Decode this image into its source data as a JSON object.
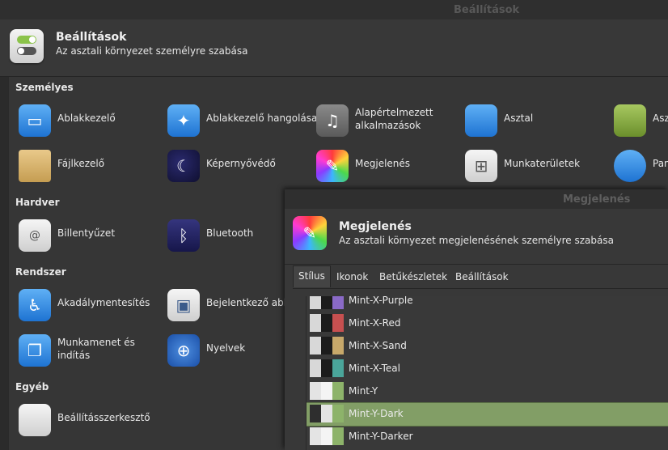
{
  "window": {
    "title": "Beállítások"
  },
  "header": {
    "title": "Beállítások",
    "subtitle": "Az asztali környezet személyre szabása"
  },
  "sections": {
    "personal": "Személyes",
    "hardware": "Hardver",
    "system": "Rendszer",
    "other": "Egyéb"
  },
  "items": {
    "window_manager": "Ablakkezelő",
    "wm_tweaks": "Ablakkezelő hangolása",
    "default_apps_1": "Alapértelmezett",
    "default_apps_2": "alkalmazások",
    "desktop": "Asztal",
    "desktop_next": "Asz",
    "file_manager": "Fájlkezelő",
    "screensaver": "Képernyővédő",
    "appearance": "Megjelenés",
    "workspaces": "Munkaterületek",
    "panel": "Pan",
    "keyboard": "Billentyűzet",
    "bluetooth": "Bluetooth",
    "accessibility": "Akadálymentesítés",
    "login": "Bejelentkező abla",
    "session_1": "Munkamenet és",
    "session_2": "indítás",
    "languages": "Nyelvek",
    "settings_editor": "Beállításszerkesztő"
  },
  "dialog": {
    "title": "Megjelenés",
    "header_title": "Megjelenés",
    "header_subtitle": "Az asztali környezet megjelenésének személyre szabása",
    "tabs": [
      "Stílus",
      "Ikonok",
      "Betűkészletek",
      "Beállítások"
    ],
    "active_tab": "Stílus",
    "themes": [
      "Mint-X-Purple",
      "Mint-X-Red",
      "Mint-X-Sand",
      "Mint-X-Teal",
      "Mint-Y",
      "Mint-Y-Dark",
      "Mint-Y-Darker"
    ],
    "selected_theme": "Mint-Y-Dark",
    "accent_colors": [
      "#8a6ac7",
      "#c75050",
      "#c7a86a",
      "#4aa59a",
      "#8db36a",
      "#8db36a",
      "#8db36a"
    ]
  }
}
